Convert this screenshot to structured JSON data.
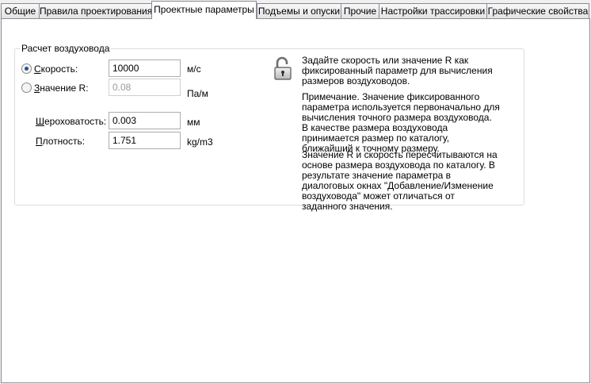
{
  "tabs": [
    {
      "label": "Общие"
    },
    {
      "label": "Правила проектирования"
    },
    {
      "label": "Проектные параметры"
    },
    {
      "label": "Подъемы и опуски"
    },
    {
      "label": "Прочие"
    },
    {
      "label": "Настройки трассировки"
    },
    {
      "label": "Графические свойства"
    }
  ],
  "active_tab": "Проектные параметры",
  "group": {
    "title": "Расчет воздуховода",
    "speed": {
      "hotkey": "С",
      "label_rest": "корость:",
      "value": "10000",
      "unit": "м/с",
      "selected": true
    },
    "r_value": {
      "hotkey": "З",
      "label_rest": "начение R:",
      "value": "0.08",
      "unit": "Па/м",
      "selected": false
    },
    "roughness": {
      "hotkey": "Ш",
      "label_rest": "ероховатость:",
      "value": "0.003",
      "unit": "мм"
    },
    "density": {
      "hotkey": "П",
      "label_rest": "лотность:",
      "value": "1.751",
      "unit": "kg/m3"
    }
  },
  "info": {
    "icon": "unlocked-padlock-icon",
    "p1": "Задайте скорость или значение R как фиксированный параметр для вычисления размеров воздуховодов.",
    "p2": "Примечание. Значение фиксированного параметра используется первоначально для вычисления точного размера воздуховода. В качестве размера воздуховода принимается размер по каталогу, ближайший к точному размеру.",
    "p3": "Значение R и скорость пересчитываются на основе размера воздуховода по каталогу. В результате значение параметра в диалоговых окнах \"Добавление/Изменение воздуховода\" может отличаться от заданного значения."
  },
  "colors": {
    "radio_dot": "#2a4f9a",
    "tab_border": "#898c95",
    "disabled_text": "#9a9a9a"
  }
}
